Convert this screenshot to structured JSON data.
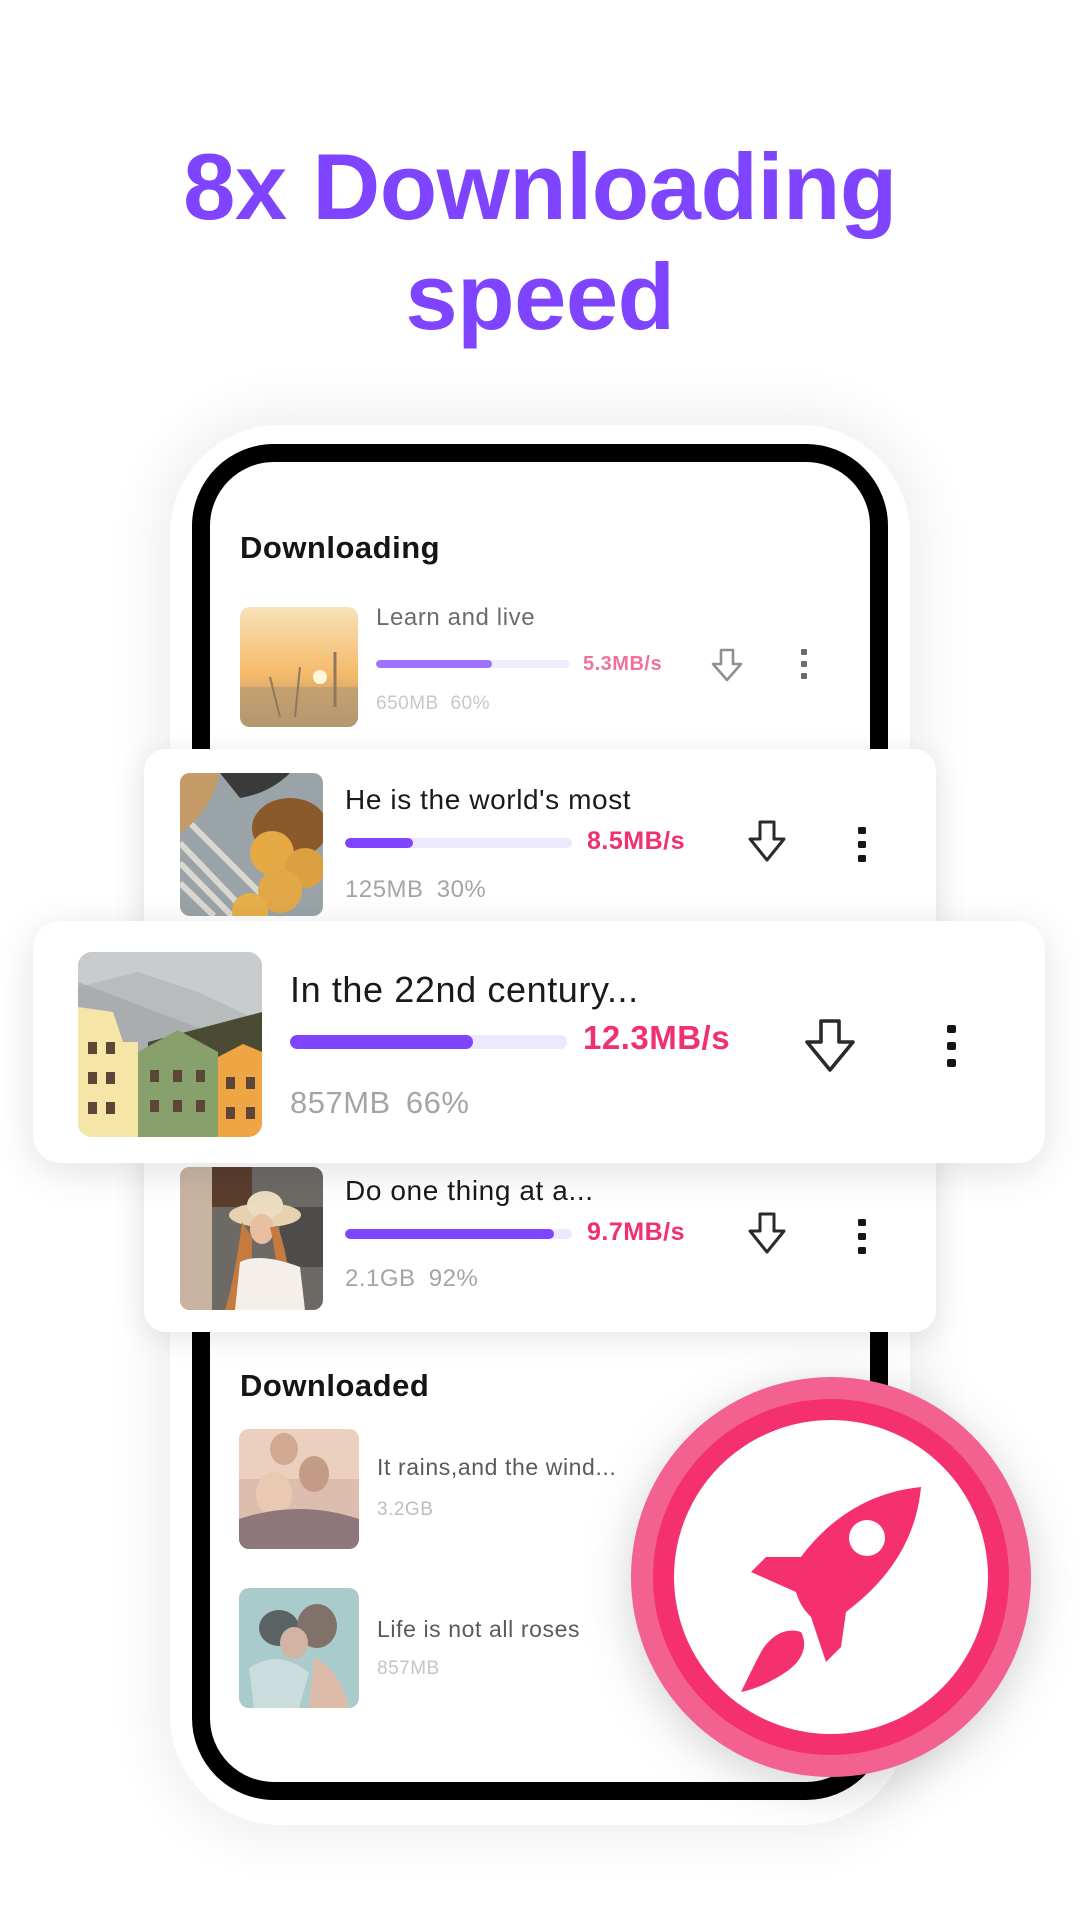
{
  "headline": {
    "line1": "8x Downloading",
    "line2": "speed"
  },
  "colors": {
    "brand_purple": "#7F44FF",
    "speed_pink": "#F0306F",
    "progress_track": "#EEE8FE",
    "badge_pink": "#F5306F"
  },
  "downloading": {
    "title": "Downloading",
    "items": [
      {
        "title": "Learn and live",
        "speed": "5.3MB/s",
        "size": "650MB",
        "percent_label": "60%",
        "progress": 0.6,
        "thumb": "sunset-field"
      },
      {
        "title": "He is the world's most",
        "speed": "8.5MB/s",
        "size": "125MB",
        "percent_label": "30%",
        "progress": 0.3,
        "thumb": "bread-basket"
      },
      {
        "title": "In the 22nd century...",
        "speed": "12.3MB/s",
        "size": "857MB",
        "percent_label": "66%",
        "progress": 0.66,
        "thumb": "colorful-houses"
      },
      {
        "title": "Do one thing at a...",
        "speed": "9.7MB/s",
        "size": "2.1GB",
        "percent_label": "92%",
        "progress": 0.92,
        "thumb": "woman-in-hat"
      }
    ]
  },
  "downloaded": {
    "title": "Downloaded",
    "items": [
      {
        "title": "It rains,and the wind...",
        "size": "3.2GB",
        "thumb": "friends-sunset"
      },
      {
        "title": "Life is not all roses",
        "size": "857MB",
        "thumb": "underwater-kiss"
      }
    ]
  },
  "icons": {
    "download": "download-arrow-icon",
    "more": "more-vertical-icon",
    "badge": "rocket-icon"
  }
}
